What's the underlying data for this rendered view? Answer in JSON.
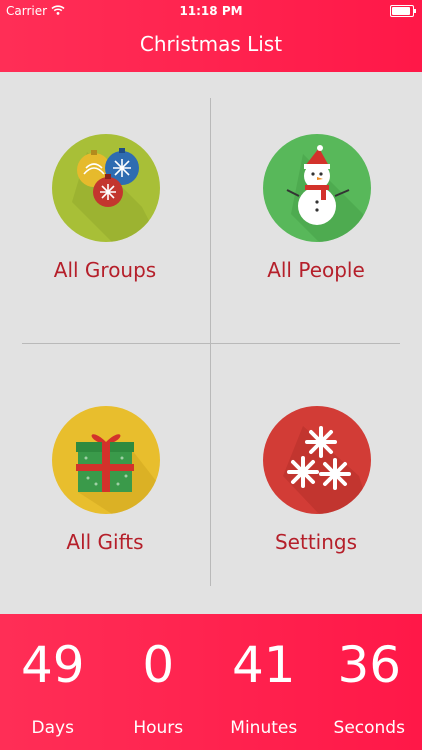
{
  "status": {
    "carrier": "Carrier",
    "time": "11:18 PM"
  },
  "header": {
    "title": "Christmas List"
  },
  "tiles": [
    {
      "label": "All Groups"
    },
    {
      "label": "All People"
    },
    {
      "label": "All Gifts"
    },
    {
      "label": "Settings"
    }
  ],
  "countdown": {
    "days": {
      "value": "49",
      "label": "Days"
    },
    "hours": {
      "value": "0",
      "label": "Hours"
    },
    "minutes": {
      "value": "41",
      "label": "Minutes"
    },
    "seconds": {
      "value": "36",
      "label": "Seconds"
    }
  },
  "colors": {
    "accent": "#ff1f4f",
    "groups_circle": "#a8bf37",
    "people_circle": "#58b85a",
    "gifts_circle": "#e8be2d",
    "settings_circle": "#d23c36",
    "label_text": "#b51f2a"
  }
}
